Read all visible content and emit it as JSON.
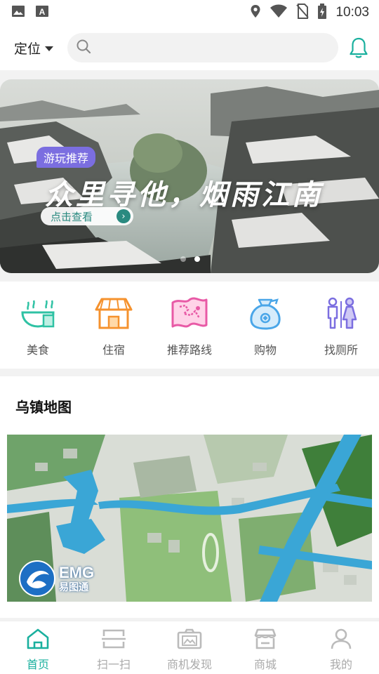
{
  "status_bar": {
    "time": "10:03"
  },
  "header": {
    "location_label": "定位",
    "search_placeholder": ""
  },
  "banner": {
    "tag": "游玩推荐",
    "title": "众里寻他，烟雨江南",
    "button_label": "点击查看"
  },
  "categories": [
    {
      "label": "美食",
      "icon": "food-bowl-icon",
      "color": "#2fc2a4"
    },
    {
      "label": "住宿",
      "icon": "hotel-icon",
      "color": "#f5922e"
    },
    {
      "label": "推荐路线",
      "icon": "map-route-icon",
      "color": "#e85aa6"
    },
    {
      "label": "购物",
      "icon": "shopping-bag-icon",
      "color": "#4aa6e8"
    },
    {
      "label": "找厕所",
      "icon": "restroom-icon",
      "color": "#7b6ee0"
    }
  ],
  "map_section": {
    "title": "乌镇地图",
    "logo_text": "EMG",
    "logo_subtext": "易图通"
  },
  "bottom_nav": [
    {
      "label": "首页",
      "icon": "home-icon",
      "active": true
    },
    {
      "label": "扫一扫",
      "icon": "scan-icon",
      "active": false
    },
    {
      "label": "商机发现",
      "icon": "discover-icon",
      "active": false
    },
    {
      "label": "商城",
      "icon": "store-icon",
      "active": false
    },
    {
      "label": "我的",
      "icon": "profile-icon",
      "active": false
    }
  ],
  "colors": {
    "accent": "#1ab09e",
    "tag_purple": "#7b6ee0"
  }
}
